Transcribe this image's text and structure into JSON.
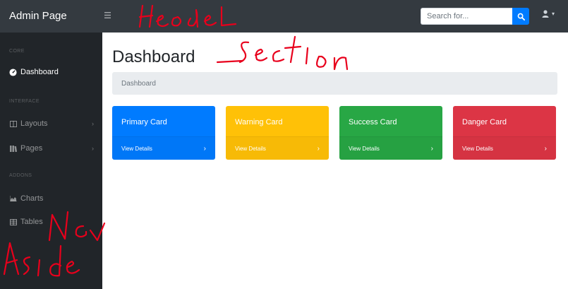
{
  "navbar": {
    "brand": "Admin Page",
    "toggle_icon": "menu-icon",
    "search_placeholder": "Search for...",
    "search_icon": "search-icon",
    "user_icon": "user-icon",
    "caret": "▾"
  },
  "sidebar": {
    "sections": [
      {
        "heading": "CORE",
        "items": [
          {
            "label": "Dashboard",
            "icon": "tachometer-icon",
            "active": true
          }
        ]
      },
      {
        "heading": "INTERFACE",
        "items": [
          {
            "label": "Layouts",
            "icon": "columns-icon",
            "chevron": "›"
          },
          {
            "label": "Pages",
            "icon": "book-icon",
            "chevron": "›"
          }
        ]
      },
      {
        "heading": "ADDONS",
        "items": [
          {
            "label": "Charts",
            "icon": "area-chart-icon"
          },
          {
            "label": "Tables",
            "icon": "table-icon"
          }
        ]
      }
    ]
  },
  "main": {
    "title": "Dashboard",
    "breadcrumb": "Dashboard",
    "cards": [
      {
        "title": "Primary Card",
        "link": "View Details",
        "arrow": "›",
        "color": "#007bff"
      },
      {
        "title": "Warning Card",
        "link": "View Details",
        "arrow": "›",
        "color": "#ffc107"
      },
      {
        "title": "Success Card",
        "link": "View Details",
        "arrow": "›",
        "color": "#28a745"
      },
      {
        "title": "Danger Card",
        "link": "View Details",
        "arrow": "›",
        "color": "#dc3545"
      }
    ]
  },
  "annotations": {
    "color": "#e8001c",
    "words": [
      "Header",
      "Section",
      "Nav",
      "Aside"
    ]
  }
}
